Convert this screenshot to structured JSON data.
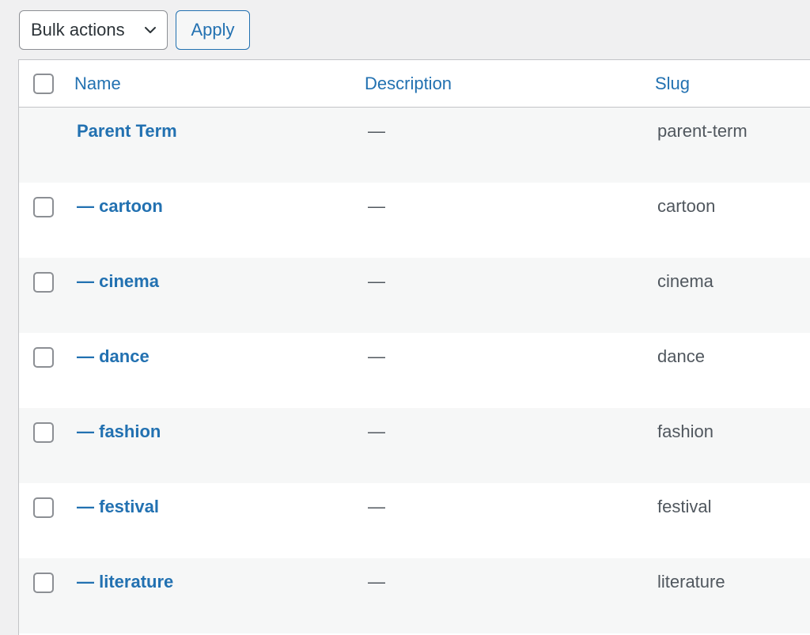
{
  "toolbar": {
    "bulk_actions_label": "Bulk actions",
    "apply_label": "Apply"
  },
  "table": {
    "columns": {
      "name": "Name",
      "description": "Description",
      "slug": "Slug"
    },
    "rows": [
      {
        "name": "Parent Term",
        "description": "—",
        "slug": "parent-term",
        "has_checkbox": false
      },
      {
        "name": "— cartoon",
        "description": "—",
        "slug": "cartoon",
        "has_checkbox": true
      },
      {
        "name": "— cinema",
        "description": "—",
        "slug": "cinema",
        "has_checkbox": true
      },
      {
        "name": "— dance",
        "description": "—",
        "slug": "dance",
        "has_checkbox": true
      },
      {
        "name": "— fashion",
        "description": "—",
        "slug": "fashion",
        "has_checkbox": true
      },
      {
        "name": "— festival",
        "description": "—",
        "slug": "festival",
        "has_checkbox": true
      },
      {
        "name": "— literature",
        "description": "—",
        "slug": "literature",
        "has_checkbox": true
      }
    ]
  },
  "colors": {
    "link": "#2271b1",
    "page_bg": "#f0f0f1",
    "alt_row": "#f6f7f7"
  }
}
